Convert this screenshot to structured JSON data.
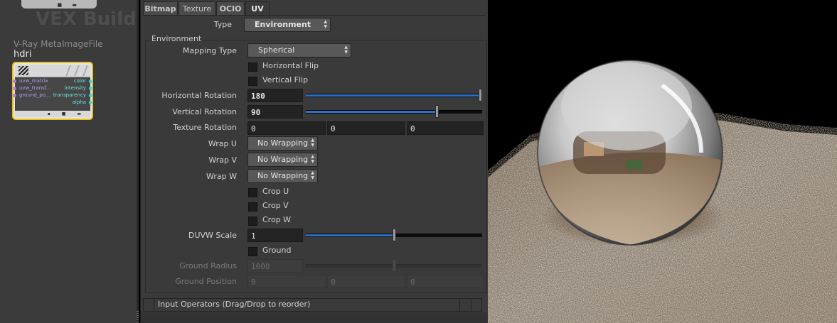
{
  "network": {
    "watermark": "VEX Builder",
    "node_type": "V-Ray MetaImageFile",
    "node_name": "hdri",
    "inputs": [
      "uvw_matrix",
      "uvw_transf...",
      "ground_po..."
    ],
    "outputs": [
      "color",
      "intensity",
      "transparency",
      "alpha"
    ],
    "selected_color": "#e8c21a"
  },
  "tabs": [
    "Bitmap",
    "Texture",
    "OCIO",
    "UV"
  ],
  "active_tab": "UV",
  "type": {
    "label": "Type",
    "value": "Environment"
  },
  "environment": {
    "title": "Environment",
    "mapping_type": {
      "label": "Mapping Type",
      "value": "Spherical"
    },
    "horizontal_flip": {
      "label": "Horizontal Flip",
      "checked": false
    },
    "vertical_flip": {
      "label": "Vertical Flip",
      "checked": false
    },
    "horizontal_rotation": {
      "label": "Horizontal Rotation",
      "value": "180",
      "fraction": 1.0
    },
    "vertical_rotation": {
      "label": "Vertical Rotation",
      "value": "90",
      "fraction": 0.75
    },
    "texture_rotation": {
      "label": "Texture Rotation",
      "values": [
        "0",
        "0",
        "0"
      ]
    },
    "wrap_u": {
      "label": "Wrap U",
      "value": "No Wrapping"
    },
    "wrap_v": {
      "label": "Wrap V",
      "value": "No Wrapping"
    },
    "wrap_w": {
      "label": "Wrap W",
      "value": "No Wrapping"
    },
    "crop_u": {
      "label": "Crop U",
      "checked": false
    },
    "crop_v": {
      "label": "Crop V",
      "checked": false
    },
    "crop_w": {
      "label": "Crop W",
      "checked": false
    },
    "duvw_scale": {
      "label": "DUVW Scale",
      "value": "1",
      "fraction": 0.5
    },
    "ground": {
      "label": "Ground",
      "checked": false
    },
    "ground_radius": {
      "label": "Ground Radius",
      "value": "1000",
      "fraction": 0.5,
      "enabled": false
    },
    "ground_position": {
      "label": "Ground Position",
      "values": [
        "0",
        "0",
        "0"
      ],
      "enabled": false
    }
  },
  "input_operators": "Input Operators (Drag/Drop to reorder)",
  "colors": {
    "slider_fill": "#2b70c4",
    "panel_bg": "#3a3a3a"
  }
}
